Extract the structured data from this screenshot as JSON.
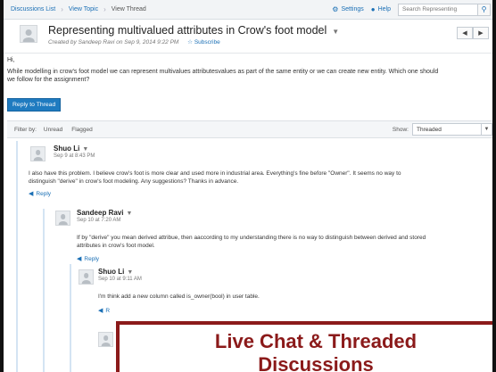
{
  "nav": {
    "breadcrumbs": [
      "Discussions List",
      "View Topic",
      "View Thread"
    ],
    "settings_label": "Settings",
    "help_label": "Help",
    "search_placeholder": "Search Representing"
  },
  "topic": {
    "title": "Representing multivalued attributes in Crow's foot model",
    "meta": "Created by Sandeep Ravi on Sep 9, 2014 9:22 PM",
    "subscribe_label": "Subscribe",
    "greeting": "Hi,",
    "body_line1": "While modelling in crow's foot model we can represent multivalues attributesvalues as part of the same entity or we can create new entity. Which one should",
    "body_line2": "we follow for the assignment?",
    "reply_button": "Reply to Thread"
  },
  "filter": {
    "label": "Filter by:",
    "options": [
      "Unread",
      "Flagged"
    ],
    "show_label": "Show:",
    "show_value": "Threaded"
  },
  "posts": [
    {
      "author": "Shuo Li",
      "date": "Sep 9 at 8:43 PM",
      "lines": [
        "I also have this problem. I believe crow's foot is more clear and used more in industrial area. Everything's fine before \"Owner\". It seems no way to",
        "distinguish \"derive\" in crow's foot modeling. Any suggestions? Thanks in advance."
      ],
      "reply_label": "Reply"
    },
    {
      "author": "Sandeep Ravi",
      "date": "Sep 10 at 7:20 AM",
      "lines": [
        "If by \"derive\" you mean derived attribue, then aaccording to my understanding there is no way to distinguish between derived and stored",
        "attributes in crow's foot model."
      ],
      "reply_label": "Reply"
    },
    {
      "author": "Shuo Li",
      "date": "Sep 10 at 9:11 AM",
      "lines": [
        "I'm think add a new column called is_owner(bool) in user table."
      ],
      "reply_label": "R"
    }
  ],
  "banner": {
    "line1": "Live Chat & Threaded",
    "line2": "Discussions"
  },
  "colors": {
    "link": "#1a6fb5",
    "primary_button": "#1f7bc0",
    "banner_accent": "#8b1a1a"
  }
}
